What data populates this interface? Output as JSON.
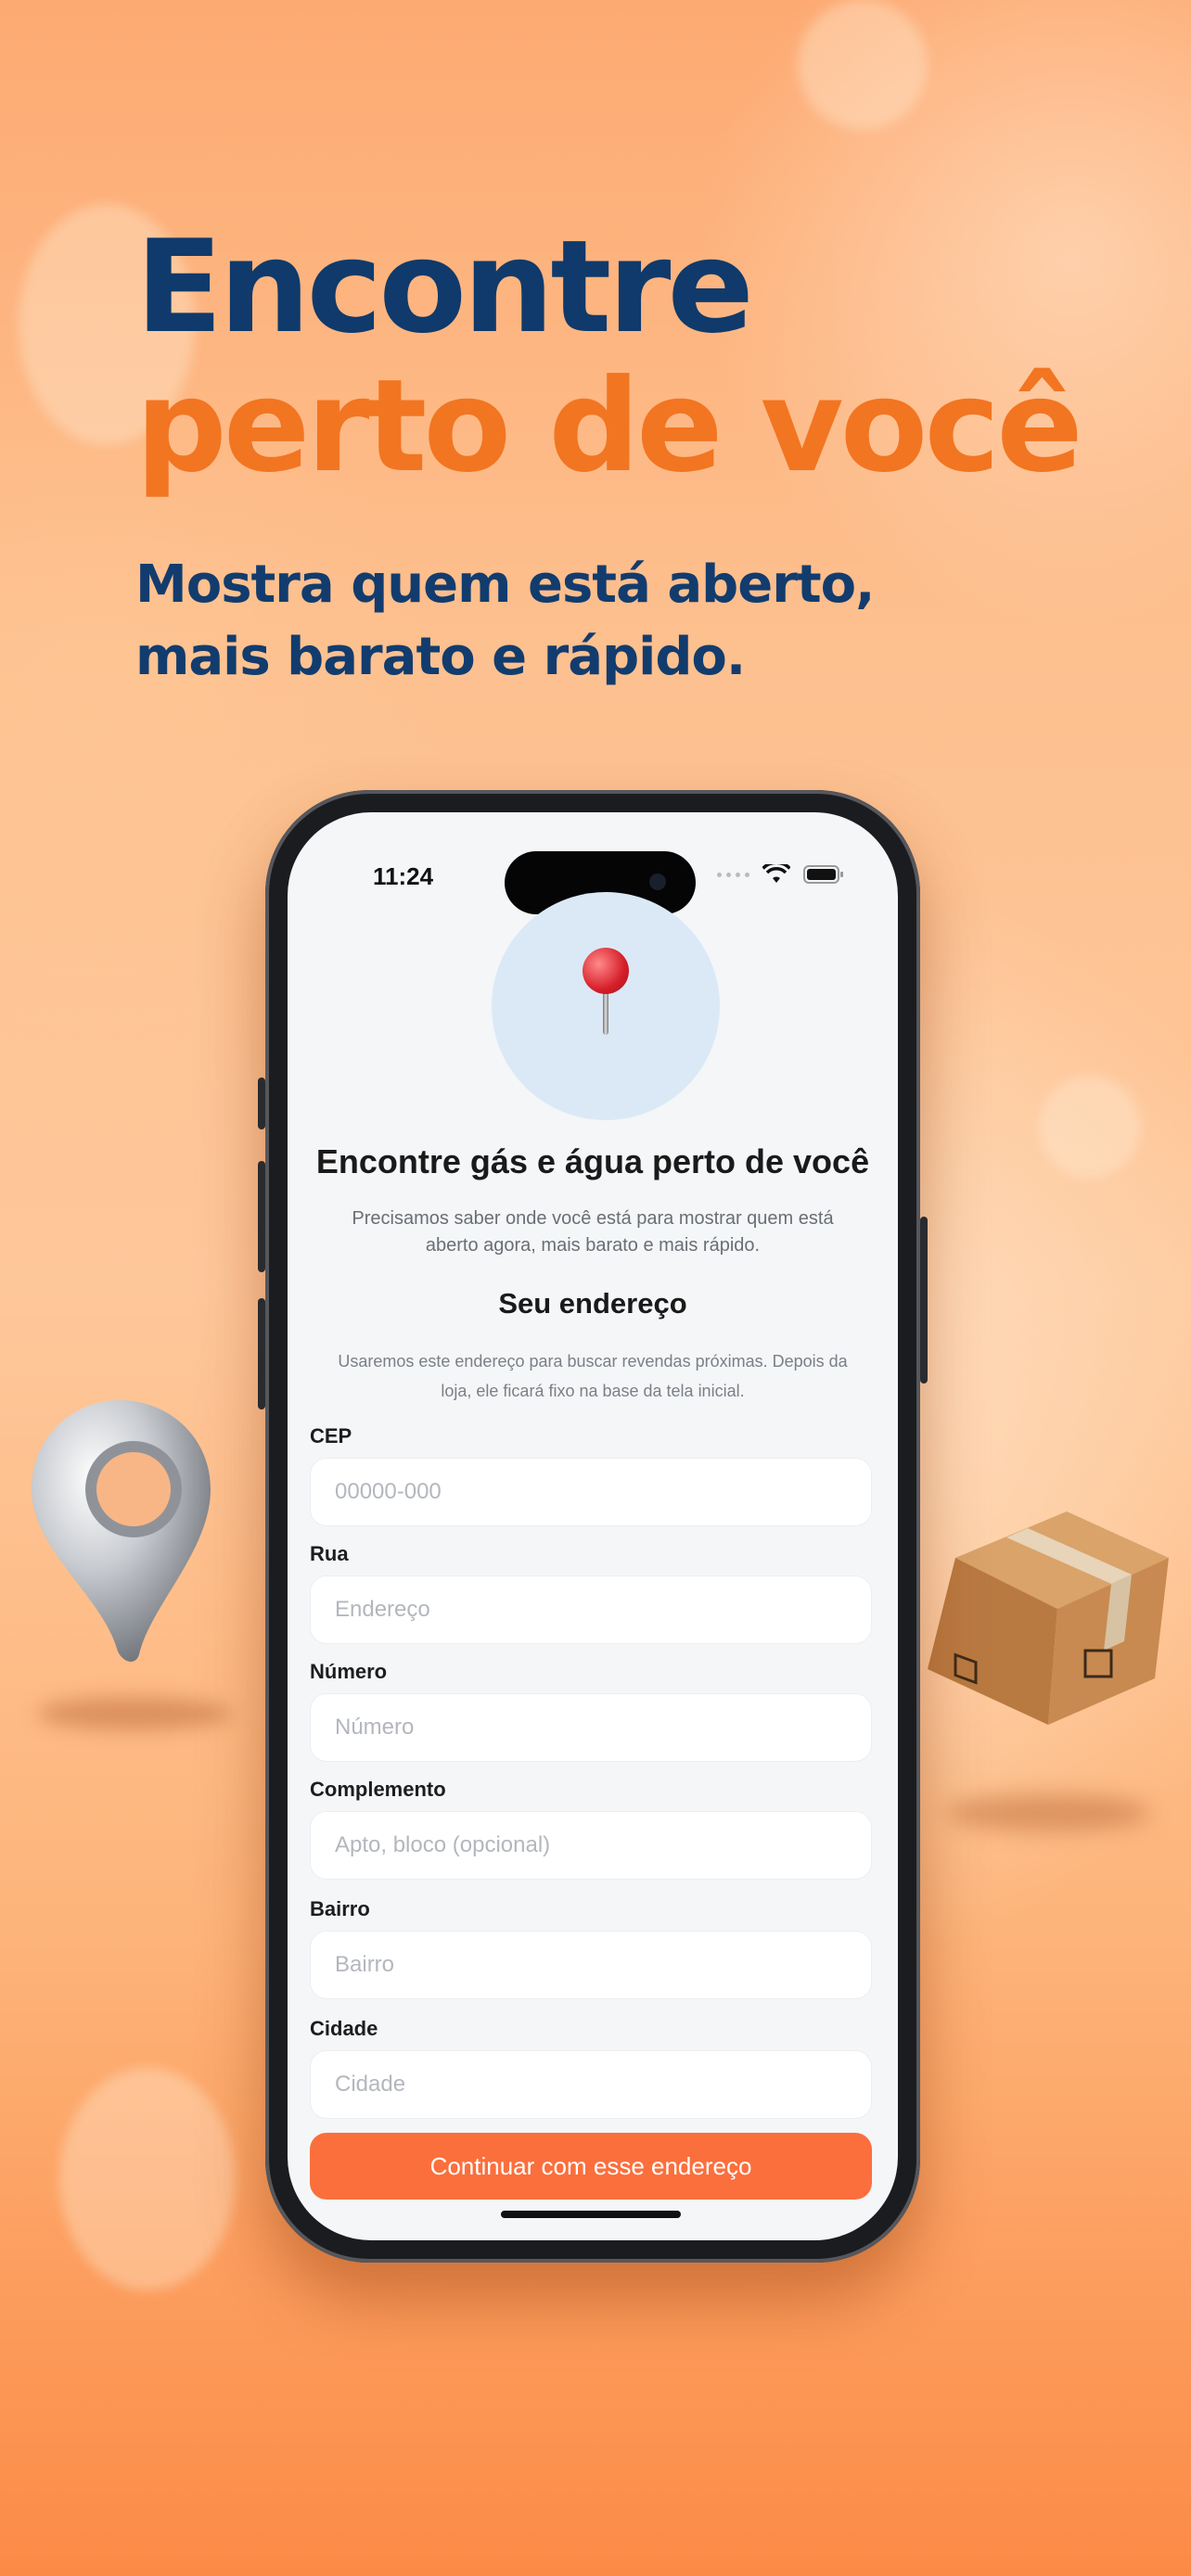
{
  "hero": {
    "line1": "Encontre",
    "line2": "perto de você",
    "subtitle_line1": "Mostra quem está aberto,",
    "subtitle_line2": "mais barato e rápido."
  },
  "status_bar": {
    "time": "11:24"
  },
  "screen": {
    "title": "Encontre gás e água perto de você",
    "description": "Precisamos saber onde você está para mostrar quem está aberto agora, mais barato e mais rápido.",
    "section_title": "Seu endereço",
    "section_description": "Usaremos este endereço para buscar revendas próximas. Depois da loja, ele ficará fixo na base da tela inicial."
  },
  "form": {
    "cep": {
      "label": "CEP",
      "placeholder": "00000-000"
    },
    "rua": {
      "label": "Rua",
      "placeholder": "Endereço"
    },
    "numero": {
      "label": "Número",
      "placeholder": "Número"
    },
    "complemento": {
      "label": "Complemento",
      "placeholder": "Apto, bloco (opcional)"
    },
    "bairro": {
      "label": "Bairro",
      "placeholder": "Bairro"
    },
    "cidade": {
      "label": "Cidade",
      "placeholder": "Cidade"
    },
    "submit_label": "Continuar com esse endereço"
  },
  "colors": {
    "navy": "#0f3a6b",
    "orange": "#f27521",
    "cta": "#fb6f3c"
  },
  "icons": [
    "pin-emoji-icon",
    "wifi-icon",
    "battery-icon",
    "location-3d-icon",
    "package-box-3d-icon"
  ]
}
